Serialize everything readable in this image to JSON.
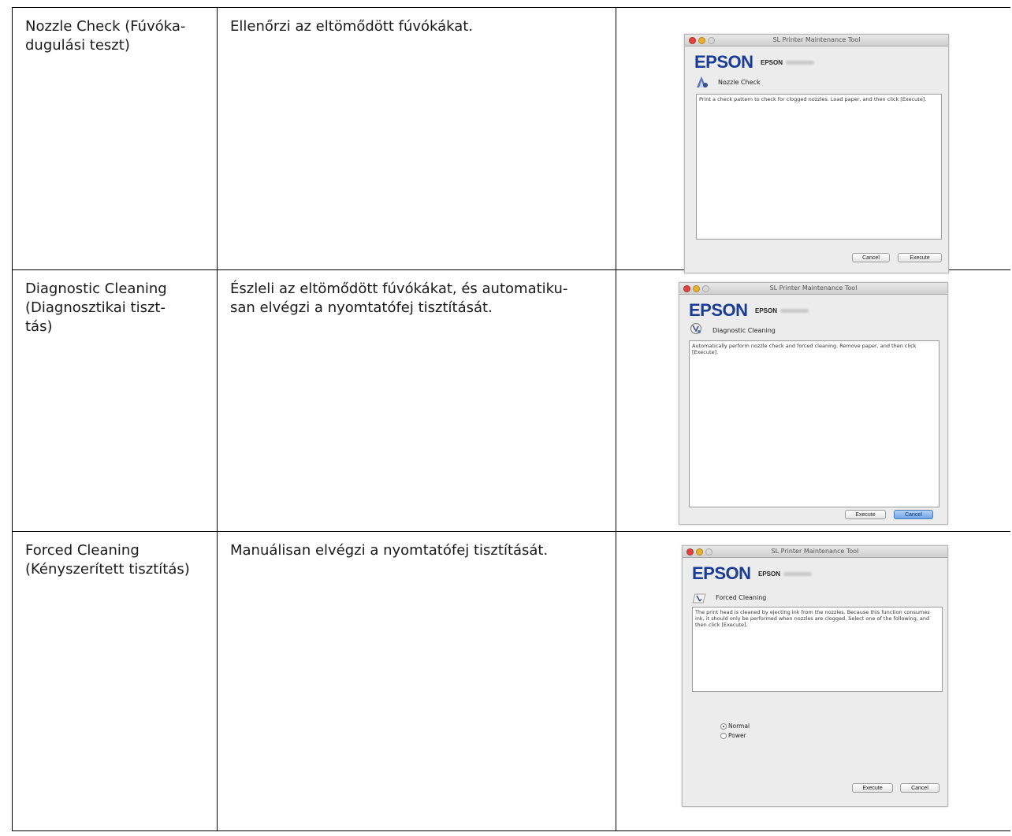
{
  "rows": [
    {
      "name_lines": [
        "Nozzle Check (Fúvóka-",
        "dugulási teszt)"
      ],
      "desc_lines": [
        "Ellenőrzi az eltömődött fúvókákat."
      ],
      "window": {
        "title": "SL Printer Maintenance Tool",
        "brand": "EPSON",
        "model": "EPSON",
        "function_title": "Nozzle Check",
        "icon": "nozzle-check-icon",
        "description": "Print a check pattern to check for clogged nozzles. Load paper, and then click [Execute].",
        "buttons": [
          "Cancel",
          "Execute"
        ]
      }
    },
    {
      "name_lines": [
        "Diagnostic Cleaning",
        "(Diagnosztikai tiszt-",
        "tás)"
      ],
      "desc_lines": [
        "Észleli az eltömődött fúvókákat, és automatiku-",
        "san elvégzi a nyomtatófej tisztítását."
      ],
      "window": {
        "title": "SL Printer Maintenance Tool",
        "brand": "EPSON",
        "model": "EPSON",
        "function_title": "Diagnostic Cleaning",
        "icon": "diagnostic-cleaning-icon",
        "description": "Automatically perform nozzle check and forced cleaning. Remove paper, and then click [Execute].",
        "buttons": [
          "Execute",
          "Cancel"
        ]
      }
    },
    {
      "name_lines": [
        "Forced Cleaning",
        "(Kényszerített tisztítás)"
      ],
      "desc_lines": [
        "Manuálisan elvégzi a nyomtatófej tisztítását."
      ],
      "window": {
        "title": "SL Printer Maintenance Tool",
        "brand": "EPSON",
        "model": "EPSON",
        "function_title": "Forced Cleaning",
        "icon": "forced-cleaning-icon",
        "description": "The print head is cleaned by ejecting ink from the nozzles. Because this function consumes ink, it should only be performed when nozzles are clogged. Select one of the following, and then click [Execute].",
        "options": [
          {
            "label": "Normal",
            "selected": true
          },
          {
            "label": "Power",
            "selected": false
          }
        ],
        "buttons": [
          "Execute",
          "Cancel"
        ]
      }
    }
  ],
  "colors": {
    "brand": "#1a3c97",
    "default_button": "#6ea4ea"
  }
}
